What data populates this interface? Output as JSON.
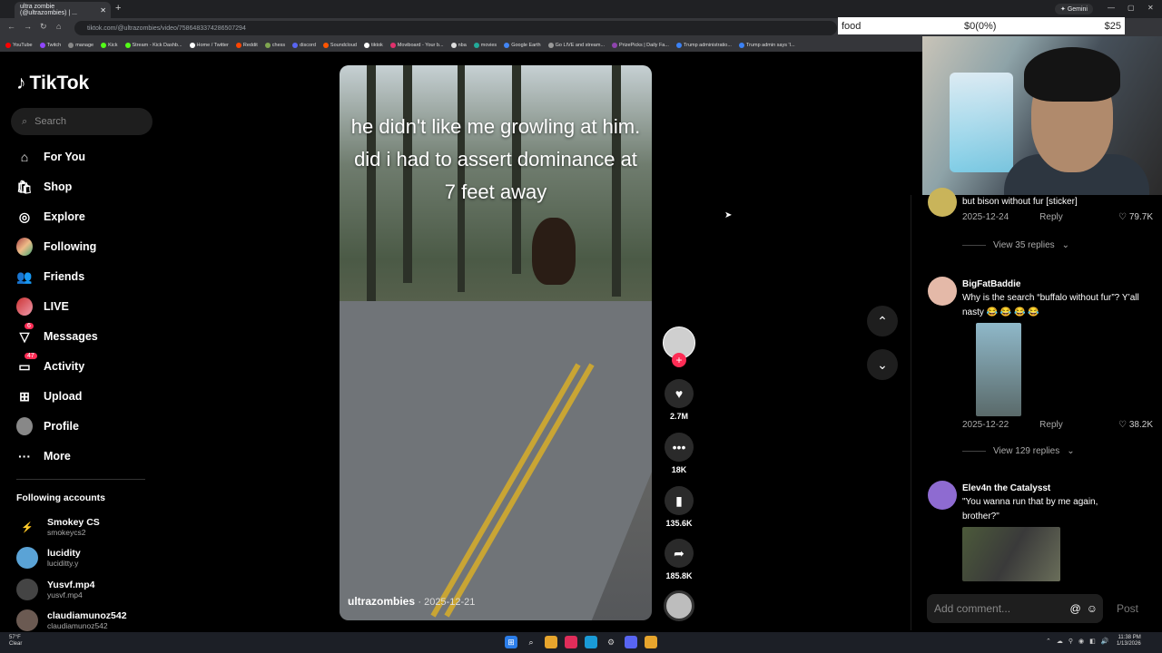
{
  "browser": {
    "tab_title": "ultra zombie (@ultrazombies) | ...",
    "url": "tiktok.com/@ultrazombies/video/7586483374286507294",
    "gemini_label": "Gemini",
    "bookmarks": [
      "YouTube",
      "Twitch",
      "manage",
      "Kick",
      "Stream - Kick Dashb...",
      "Home / Twitter",
      "Reddit",
      "chess",
      "discord",
      "Soundcloud",
      "tiktok",
      "Moviboard - Your b...",
      "nba",
      "movies",
      "Google Earth",
      "Go LIVE and stream...",
      "PrizePicks | Daily Fa...",
      "Trump administratio...",
      "Trump admin says 'I..."
    ]
  },
  "overlay": {
    "label": "food",
    "value": "$0(0%)",
    "goal": "$25"
  },
  "sidebar": {
    "logo": "TikTok",
    "search_placeholder": "Search",
    "items": [
      {
        "label": "For You",
        "icon": "home-icon"
      },
      {
        "label": "Shop",
        "icon": "shop-icon"
      },
      {
        "label": "Explore",
        "icon": "compass-icon"
      },
      {
        "label": "Following",
        "icon": "avatar-icon"
      },
      {
        "label": "Friends",
        "icon": "friends-icon"
      },
      {
        "label": "LIVE",
        "icon": "avatar-icon"
      },
      {
        "label": "Messages",
        "icon": "send-icon",
        "badge": "6"
      },
      {
        "label": "Activity",
        "icon": "inbox-icon",
        "badge": "47"
      },
      {
        "label": "Upload",
        "icon": "upload-icon"
      },
      {
        "label": "Profile",
        "icon": "avatar-icon"
      },
      {
        "label": "More",
        "icon": "more-icon"
      }
    ],
    "following_title": "Following accounts",
    "accounts": [
      {
        "name": "Smokey CS",
        "handle": "smokeycs2"
      },
      {
        "name": "lucidity",
        "handle": "luciditty.y"
      },
      {
        "name": "Yusvf.mp4",
        "handle": "yusvf.mp4"
      },
      {
        "name": "claudiamunoz542",
        "handle": "claudiamunoz542"
      }
    ]
  },
  "video": {
    "caption": "he didn't like me growling at him.  did i had to assert dominance at 7 feet away",
    "author": "ultrazombies",
    "date": "· 2025-12-21"
  },
  "actions": {
    "likes": "2.7M",
    "comments": "18K",
    "saves": "135.6K",
    "shares": "185.8K"
  },
  "comments": [
    {
      "text": "but bison without fur [sticker]",
      "date": "2025-12-24",
      "reply": "Reply",
      "likes": "79.7K",
      "view_replies": "View 35 replies"
    },
    {
      "name": "BigFatBaddie",
      "text": "Why is the search “buffalo without fur”? Y’all nasty 😂 😂 😂 😂",
      "date": "2025-12-22",
      "reply": "Reply",
      "likes": "38.2K",
      "view_replies": "View 129 replies"
    },
    {
      "name": "Elev4n the Catalysst",
      "text": "\"You wanna run that by me again, brother?\""
    }
  ],
  "comment_input": {
    "placeholder": "Add comment...",
    "post": "Post"
  },
  "taskbar": {
    "temp": "57°F",
    "weather": "Clear",
    "time": "11:38 PM",
    "date": "1/13/2026"
  }
}
